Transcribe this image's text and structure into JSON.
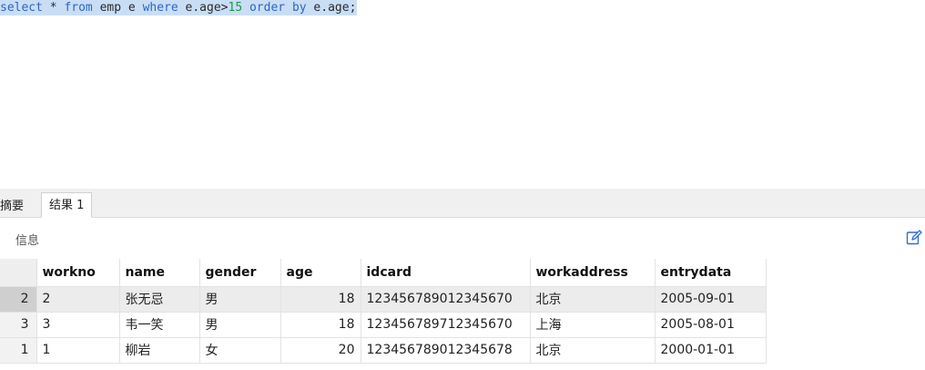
{
  "editor": {
    "sql_tokens": [
      {
        "text": "select",
        "cls": "kw"
      },
      {
        "text": " * ",
        "cls": "plain"
      },
      {
        "text": "from",
        "cls": "kw"
      },
      {
        "text": " emp e ",
        "cls": "plain"
      },
      {
        "text": "where",
        "cls": "kw"
      },
      {
        "text": " e.age>",
        "cls": "plain"
      },
      {
        "text": "15",
        "cls": "num"
      },
      {
        "text": " ",
        "cls": "plain"
      },
      {
        "text": "order by",
        "cls": "kw"
      },
      {
        "text": " e.age;",
        "cls": "plain"
      }
    ]
  },
  "tabs": {
    "summary": "摘要",
    "result": "结果 1"
  },
  "toolbar": {
    "info_label": "信息",
    "edit_icon": "edit-pencil-icon"
  },
  "grid": {
    "columns": [
      "workno",
      "name",
      "gender",
      "age",
      "idcard",
      "workaddress",
      "entrydata"
    ],
    "rows": [
      {
        "rownum": "2",
        "workno": "2",
        "name": "张无忌",
        "gender": "男",
        "age": "18",
        "idcard": "123456789012345670",
        "workaddress": "北京",
        "entrydata": "2005-09-01",
        "selected": true
      },
      {
        "rownum": "3",
        "workno": "3",
        "name": "韦一笑",
        "gender": "男",
        "age": "18",
        "idcard": "123456789712345670",
        "workaddress": "上海",
        "entrydata": "2005-08-01",
        "selected": false
      },
      {
        "rownum": "1",
        "workno": "1",
        "name": "柳岩",
        "gender": "女",
        "age": "20",
        "idcard": "123456789012345678",
        "workaddress": "北京",
        "entrydata": "2000-01-01",
        "selected": false
      }
    ]
  },
  "colors": {
    "keyword": "#2b66c4",
    "number": "#1a9a48",
    "selection": "#c9def5"
  }
}
